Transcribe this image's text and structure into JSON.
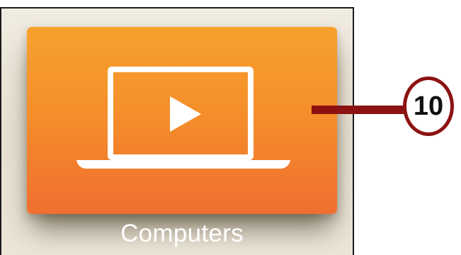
{
  "tile": {
    "label": "Computers",
    "icon": "laptop-play-icon",
    "gradient_top": "#f7a12e",
    "gradient_bottom": "#f06f2f"
  },
  "callout": {
    "number": "10",
    "color": "#8c1212"
  }
}
